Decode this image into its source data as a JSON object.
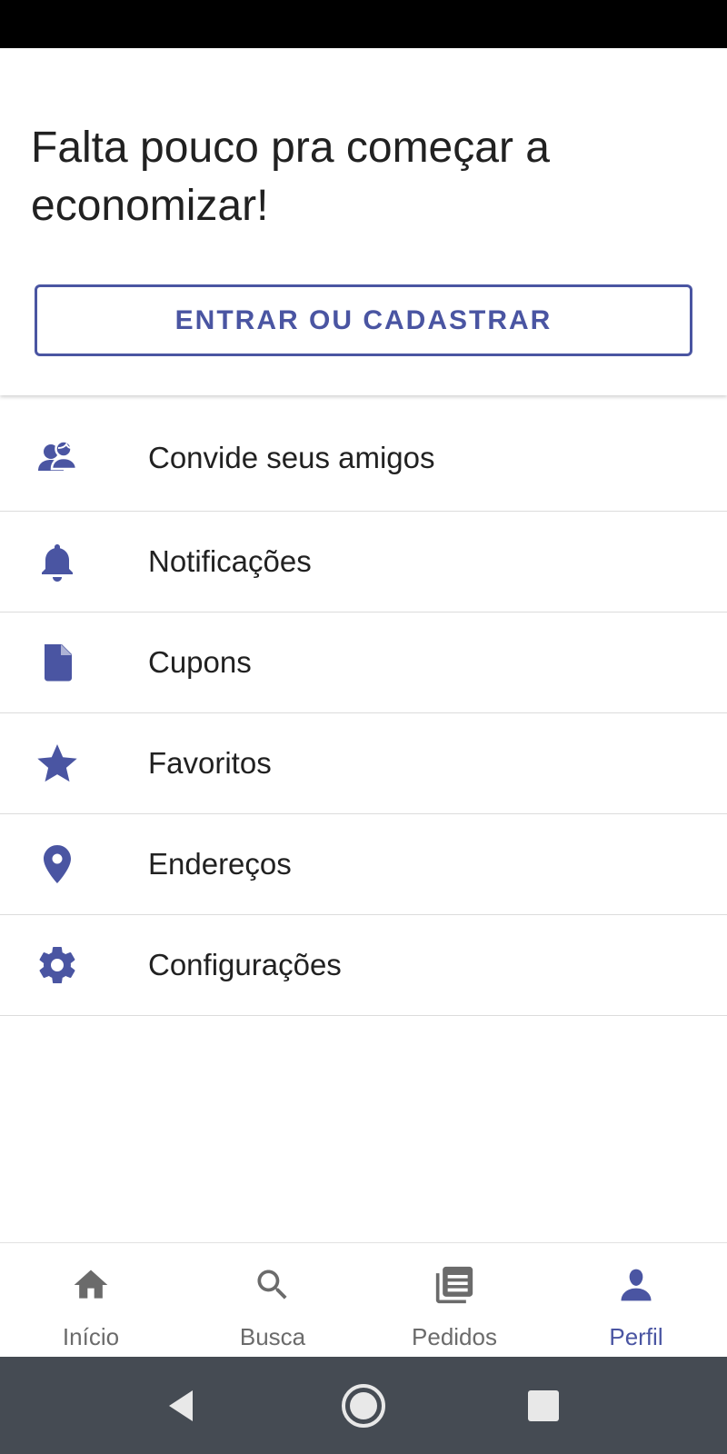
{
  "header": {
    "headline": "Falta pouco pra começar a economizar!",
    "login_button": "ENTRAR OU CADASTRAR"
  },
  "menu": {
    "items": [
      {
        "label": "Convide seus amigos",
        "icon": "invite-friends-icon"
      },
      {
        "label": "Notificações",
        "icon": "bell-icon"
      },
      {
        "label": "Cupons",
        "icon": "coupon-document-icon"
      },
      {
        "label": "Favoritos",
        "icon": "star-icon"
      },
      {
        "label": "Endereços",
        "icon": "location-pin-icon"
      },
      {
        "label": "Configurações",
        "icon": "gear-icon"
      }
    ]
  },
  "bottom_nav": {
    "active": "Perfil",
    "items": [
      {
        "label": "Início",
        "icon": "home-icon"
      },
      {
        "label": "Busca",
        "icon": "search-icon"
      },
      {
        "label": "Pedidos",
        "icon": "orders-list-icon"
      },
      {
        "label": "Perfil",
        "icon": "profile-icon"
      }
    ]
  },
  "colors": {
    "accent": "#4a55a2",
    "inactive": "#6b6b6b",
    "text": "#212121",
    "system_nav": "#454b53"
  }
}
